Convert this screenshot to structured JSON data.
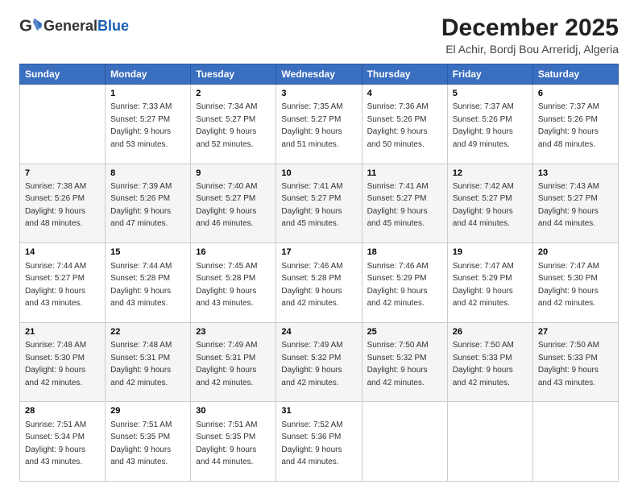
{
  "header": {
    "logo_general": "General",
    "logo_blue": "Blue",
    "month": "December 2025",
    "location": "El Achir, Bordj Bou Arreridj, Algeria"
  },
  "days_of_week": [
    "Sunday",
    "Monday",
    "Tuesday",
    "Wednesday",
    "Thursday",
    "Friday",
    "Saturday"
  ],
  "weeks": [
    [
      {
        "day": "",
        "sunrise": "",
        "sunset": "",
        "daylight": ""
      },
      {
        "day": "1",
        "sunrise": "Sunrise: 7:33 AM",
        "sunset": "Sunset: 5:27 PM",
        "daylight": "Daylight: 9 hours and 53 minutes."
      },
      {
        "day": "2",
        "sunrise": "Sunrise: 7:34 AM",
        "sunset": "Sunset: 5:27 PM",
        "daylight": "Daylight: 9 hours and 52 minutes."
      },
      {
        "day": "3",
        "sunrise": "Sunrise: 7:35 AM",
        "sunset": "Sunset: 5:27 PM",
        "daylight": "Daylight: 9 hours and 51 minutes."
      },
      {
        "day": "4",
        "sunrise": "Sunrise: 7:36 AM",
        "sunset": "Sunset: 5:26 PM",
        "daylight": "Daylight: 9 hours and 50 minutes."
      },
      {
        "day": "5",
        "sunrise": "Sunrise: 7:37 AM",
        "sunset": "Sunset: 5:26 PM",
        "daylight": "Daylight: 9 hours and 49 minutes."
      },
      {
        "day": "6",
        "sunrise": "Sunrise: 7:37 AM",
        "sunset": "Sunset: 5:26 PM",
        "daylight": "Daylight: 9 hours and 48 minutes."
      }
    ],
    [
      {
        "day": "7",
        "sunrise": "Sunrise: 7:38 AM",
        "sunset": "Sunset: 5:26 PM",
        "daylight": "Daylight: 9 hours and 48 minutes."
      },
      {
        "day": "8",
        "sunrise": "Sunrise: 7:39 AM",
        "sunset": "Sunset: 5:26 PM",
        "daylight": "Daylight: 9 hours and 47 minutes."
      },
      {
        "day": "9",
        "sunrise": "Sunrise: 7:40 AM",
        "sunset": "Sunset: 5:27 PM",
        "daylight": "Daylight: 9 hours and 46 minutes."
      },
      {
        "day": "10",
        "sunrise": "Sunrise: 7:41 AM",
        "sunset": "Sunset: 5:27 PM",
        "daylight": "Daylight: 9 hours and 45 minutes."
      },
      {
        "day": "11",
        "sunrise": "Sunrise: 7:41 AM",
        "sunset": "Sunset: 5:27 PM",
        "daylight": "Daylight: 9 hours and 45 minutes."
      },
      {
        "day": "12",
        "sunrise": "Sunrise: 7:42 AM",
        "sunset": "Sunset: 5:27 PM",
        "daylight": "Daylight: 9 hours and 44 minutes."
      },
      {
        "day": "13",
        "sunrise": "Sunrise: 7:43 AM",
        "sunset": "Sunset: 5:27 PM",
        "daylight": "Daylight: 9 hours and 44 minutes."
      }
    ],
    [
      {
        "day": "14",
        "sunrise": "Sunrise: 7:44 AM",
        "sunset": "Sunset: 5:27 PM",
        "daylight": "Daylight: 9 hours and 43 minutes."
      },
      {
        "day": "15",
        "sunrise": "Sunrise: 7:44 AM",
        "sunset": "Sunset: 5:28 PM",
        "daylight": "Daylight: 9 hours and 43 minutes."
      },
      {
        "day": "16",
        "sunrise": "Sunrise: 7:45 AM",
        "sunset": "Sunset: 5:28 PM",
        "daylight": "Daylight: 9 hours and 43 minutes."
      },
      {
        "day": "17",
        "sunrise": "Sunrise: 7:46 AM",
        "sunset": "Sunset: 5:28 PM",
        "daylight": "Daylight: 9 hours and 42 minutes."
      },
      {
        "day": "18",
        "sunrise": "Sunrise: 7:46 AM",
        "sunset": "Sunset: 5:29 PM",
        "daylight": "Daylight: 9 hours and 42 minutes."
      },
      {
        "day": "19",
        "sunrise": "Sunrise: 7:47 AM",
        "sunset": "Sunset: 5:29 PM",
        "daylight": "Daylight: 9 hours and 42 minutes."
      },
      {
        "day": "20",
        "sunrise": "Sunrise: 7:47 AM",
        "sunset": "Sunset: 5:30 PM",
        "daylight": "Daylight: 9 hours and 42 minutes."
      }
    ],
    [
      {
        "day": "21",
        "sunrise": "Sunrise: 7:48 AM",
        "sunset": "Sunset: 5:30 PM",
        "daylight": "Daylight: 9 hours and 42 minutes."
      },
      {
        "day": "22",
        "sunrise": "Sunrise: 7:48 AM",
        "sunset": "Sunset: 5:31 PM",
        "daylight": "Daylight: 9 hours and 42 minutes."
      },
      {
        "day": "23",
        "sunrise": "Sunrise: 7:49 AM",
        "sunset": "Sunset: 5:31 PM",
        "daylight": "Daylight: 9 hours and 42 minutes."
      },
      {
        "day": "24",
        "sunrise": "Sunrise: 7:49 AM",
        "sunset": "Sunset: 5:32 PM",
        "daylight": "Daylight: 9 hours and 42 minutes."
      },
      {
        "day": "25",
        "sunrise": "Sunrise: 7:50 AM",
        "sunset": "Sunset: 5:32 PM",
        "daylight": "Daylight: 9 hours and 42 minutes."
      },
      {
        "day": "26",
        "sunrise": "Sunrise: 7:50 AM",
        "sunset": "Sunset: 5:33 PM",
        "daylight": "Daylight: 9 hours and 42 minutes."
      },
      {
        "day": "27",
        "sunrise": "Sunrise: 7:50 AM",
        "sunset": "Sunset: 5:33 PM",
        "daylight": "Daylight: 9 hours and 43 minutes."
      }
    ],
    [
      {
        "day": "28",
        "sunrise": "Sunrise: 7:51 AM",
        "sunset": "Sunset: 5:34 PM",
        "daylight": "Daylight: 9 hours and 43 minutes."
      },
      {
        "day": "29",
        "sunrise": "Sunrise: 7:51 AM",
        "sunset": "Sunset: 5:35 PM",
        "daylight": "Daylight: 9 hours and 43 minutes."
      },
      {
        "day": "30",
        "sunrise": "Sunrise: 7:51 AM",
        "sunset": "Sunset: 5:35 PM",
        "daylight": "Daylight: 9 hours and 44 minutes."
      },
      {
        "day": "31",
        "sunrise": "Sunrise: 7:52 AM",
        "sunset": "Sunset: 5:36 PM",
        "daylight": "Daylight: 9 hours and 44 minutes."
      },
      {
        "day": "",
        "sunrise": "",
        "sunset": "",
        "daylight": ""
      },
      {
        "day": "",
        "sunrise": "",
        "sunset": "",
        "daylight": ""
      },
      {
        "day": "",
        "sunrise": "",
        "sunset": "",
        "daylight": ""
      }
    ]
  ]
}
